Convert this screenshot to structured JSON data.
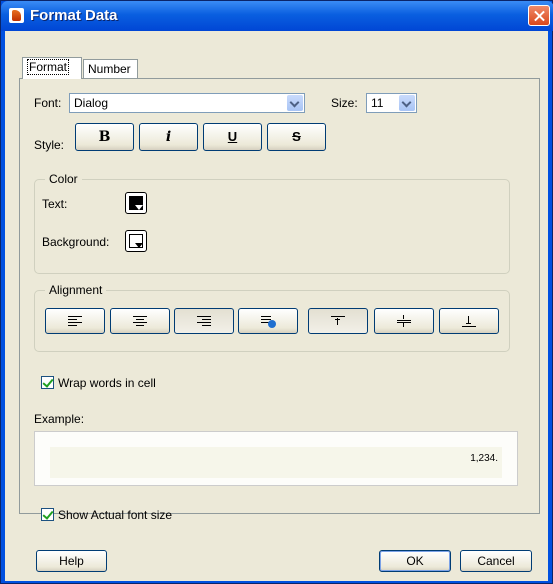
{
  "window": {
    "title": "Format Data"
  },
  "tabs": [
    {
      "label": "Format"
    },
    {
      "label": "Number"
    }
  ],
  "font": {
    "label": "Font:",
    "value": "Dialog",
    "size_label": "Size:",
    "size_value": "11"
  },
  "style": {
    "label": "Style:",
    "bold": "B",
    "italic": "i",
    "underline": "U",
    "strike": "S"
  },
  "color": {
    "title": "Color",
    "text_label": "Text:",
    "background_label": "Background:",
    "text_color": "#000000",
    "background_color": "#ffffff"
  },
  "alignment": {
    "title": "Alignment"
  },
  "wrap": {
    "label": "Wrap words in cell",
    "checked": true
  },
  "example": {
    "label": "Example:",
    "value": "1,234."
  },
  "actual_size": {
    "label": "Show Actual font size",
    "checked": true
  },
  "footer": {
    "help": "Help",
    "ok": "OK",
    "cancel": "Cancel"
  }
}
